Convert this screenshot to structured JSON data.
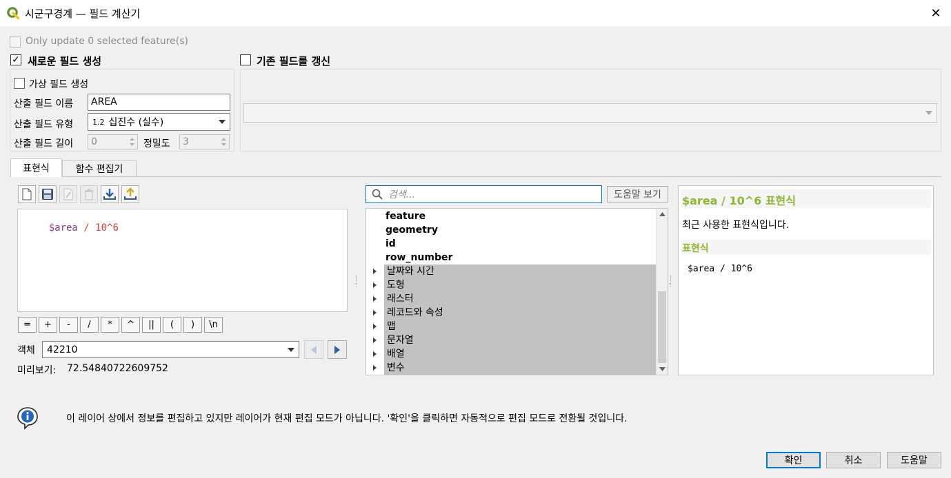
{
  "window": {
    "title": "시군구경계 — 필드 계산기",
    "close_glyph": "✕"
  },
  "top": {
    "only_update_label": "Only update 0 selected feature(s)",
    "create_new_label": "새로운 필드 생성",
    "update_existing_label": "기존 필드를 갱신",
    "virtual_field_label": "가상 필드 생성",
    "output_name_label": "산출 필드 이름",
    "output_name_value": "AREA",
    "output_type_label": "산출 필드 유형",
    "output_type_badge": "1.2",
    "output_type_value": "십진수 (실수)",
    "output_length_label": "산출 필드 길이",
    "output_length_value": "0",
    "precision_label": "정밀도",
    "precision_value": "3"
  },
  "tabs": [
    {
      "label": "표현식",
      "active": true
    },
    {
      "label": "함수 편집기",
      "active": false
    }
  ],
  "editor": {
    "expression_var": "$area",
    "expression_rest": " / 10^6"
  },
  "operators": [
    "=",
    "+",
    "-",
    "/",
    "*",
    "^",
    "||",
    "(",
    ")",
    "\\n"
  ],
  "feature": {
    "label": "객체",
    "value": "42210"
  },
  "preview": {
    "label": "미리보기:",
    "value": "72.54840722609752"
  },
  "search": {
    "placeholder": "검색...",
    "help_button": "도움말 보기"
  },
  "tree": {
    "plain_items": [
      "feature",
      "geometry",
      "id",
      "row_number"
    ],
    "group_items": [
      "날짜와 시간",
      "도형",
      "래스터",
      "레코드와 속성",
      "맵",
      "문자열",
      "배열",
      "변수"
    ]
  },
  "help_panel": {
    "title": "$area / 10^6 표현식",
    "description": "최근 사용한 표현식입니다.",
    "section_label": "표현식",
    "code": "$area / 10^6"
  },
  "info": {
    "message": "이 레이어 상에서 정보를 편집하고 있지만 레이어가 현재 편집 모드가 아닙니다. '확인'을 클릭하면 자동적으로 편집 모드로 전환될 것입니다."
  },
  "buttons": {
    "ok": "확인",
    "cancel": "취소",
    "help": "도움말"
  },
  "colors": {
    "accent": "#0078d7",
    "help_title": "#8db82f",
    "expr_var": "#8b3a8b",
    "expr_op": "#d23c3c",
    "qgis_green": "#589632"
  }
}
